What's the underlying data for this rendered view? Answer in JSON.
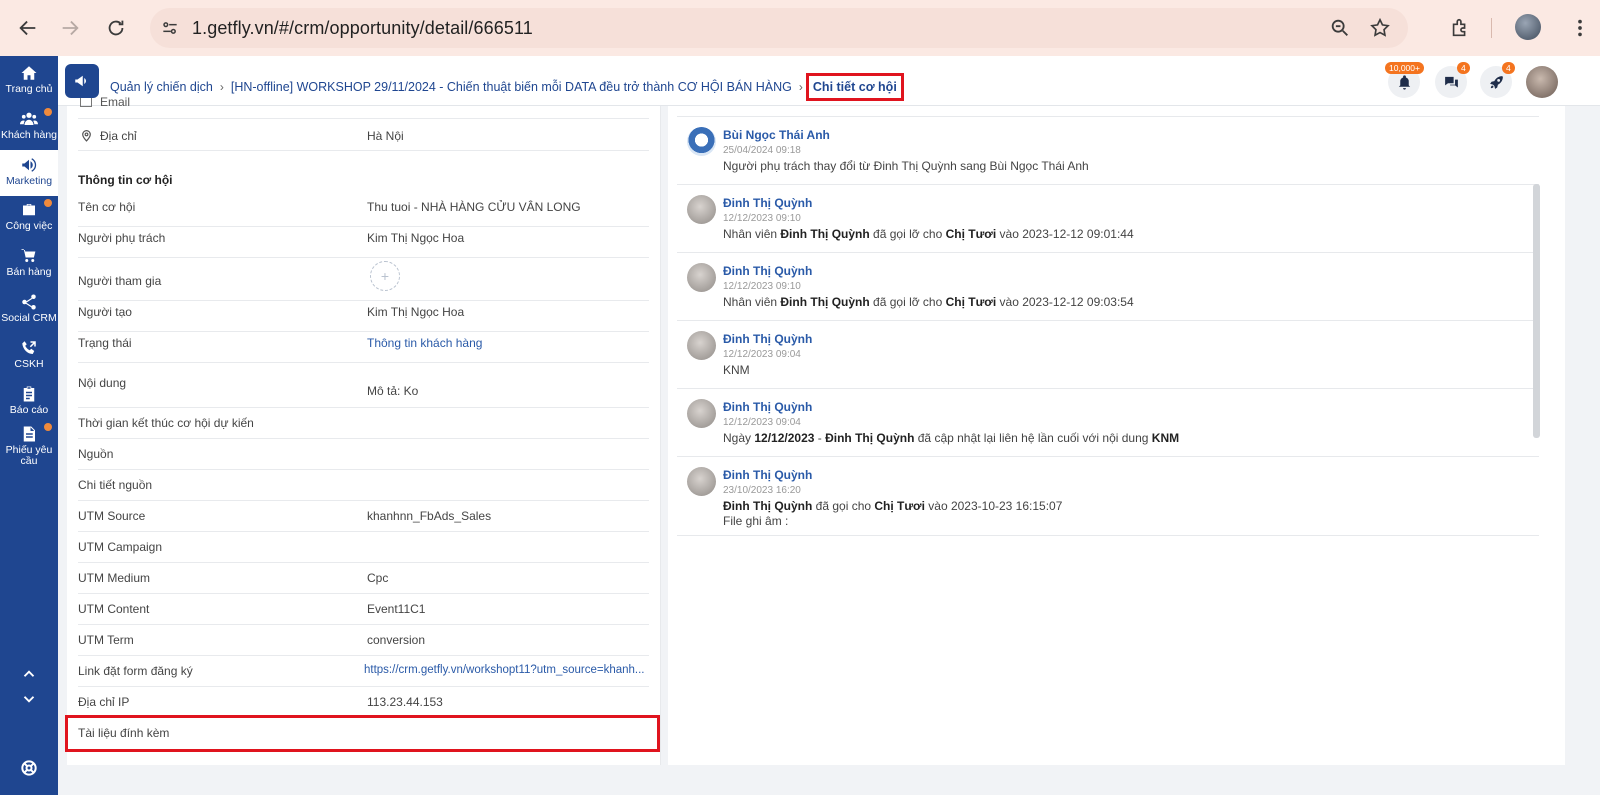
{
  "browser": {
    "url": "1.getfly.vn/#/crm/opportunity/detail/666511"
  },
  "sidebar": {
    "items": [
      {
        "label": "Trang chủ",
        "icon": "home-icon",
        "dot": false
      },
      {
        "label": "Khách hàng",
        "icon": "users-icon",
        "dot": true
      },
      {
        "label": "Marketing",
        "icon": "megaphone-icon",
        "dot": false,
        "active": true
      },
      {
        "label": "Công việc",
        "icon": "briefcase-icon",
        "dot": true
      },
      {
        "label": "Bán hàng",
        "icon": "cart-icon",
        "dot": false
      },
      {
        "label": "Social CRM",
        "icon": "share-icon",
        "dot": false
      },
      {
        "label": "CSKH",
        "icon": "phone-icon",
        "dot": false
      },
      {
        "label": "Báo cáo",
        "icon": "clipboard-icon",
        "dot": false
      },
      {
        "label": "Phiếu yêu cầu",
        "icon": "document-icon",
        "dot": true
      }
    ]
  },
  "header": {
    "breadcrumb": [
      "Quản lý chiến dịch",
      "[HN-offline] WORKSHOP 29/11/2024 - Chiến thuật biến mỗi DATA đều trở thành CƠ HỘI BÁN HÀNG",
      "Chi tiết cơ hội"
    ],
    "notifications_badge": "10,000+",
    "chat_badge": "4",
    "rocket_badge": "4"
  },
  "contact": {
    "email_label": "Email",
    "address_label": "Địa chỉ",
    "address_value": "Hà Nội"
  },
  "opportunity": {
    "section_title": "Thông tin cơ hội",
    "fields": [
      {
        "label": "Tên cơ hội",
        "value": "Thu tuoi - NHÀ HÀNG CỬU VÂN LONG"
      },
      {
        "label": "Người phụ trách",
        "value": "Kim Thị Ngọc Hoa"
      },
      {
        "label": "Người tham gia",
        "value": "+"
      },
      {
        "label": "Người tạo",
        "value": "Kim Thị Ngọc Hoa"
      },
      {
        "label": "Trạng thái",
        "value": "Thông tin khách hàng"
      },
      {
        "label": "Nội dung",
        "value": "Mô tả: Ko"
      },
      {
        "label": "Thời gian kết thúc cơ hội dự kiến",
        "value": ""
      },
      {
        "label": "Nguồn",
        "value": ""
      },
      {
        "label": "Chi tiết nguồn",
        "value": ""
      },
      {
        "label": "UTM Source",
        "value": "khanhnn_FbAds_Sales"
      },
      {
        "label": "UTM Campaign",
        "value": ""
      },
      {
        "label": "UTM Medium",
        "value": "Cpc"
      },
      {
        "label": "UTM Content",
        "value": "Event11C1"
      },
      {
        "label": "UTM Term",
        "value": "conversion"
      },
      {
        "label": "Link đặt form đăng ký",
        "value": "https://crm.getfly.vn/workshopt11?utm_source=khanh..."
      },
      {
        "label": "Địa chỉ IP",
        "value": "113.23.44.153"
      },
      {
        "label": "Tài liệu đính kèm",
        "value": ""
      }
    ]
  },
  "activity": [
    {
      "name": "Bùi Ngọc Thái Anh",
      "time": "25/04/2024 09:18",
      "text": "Người phụ trách thay đổi từ Đinh Thị Quỳnh sang Bùi Ngọc Thái Anh"
    },
    {
      "name": "Đinh Thị Quỳnh",
      "time": "12/12/2023 09:10",
      "t1": "Nhân viên ",
      "b1": "Đinh Thị Quỳnh",
      "t2": " đã gọi lỡ cho ",
      "b2": "Chị Tươi",
      "t3": " vào 2023-12-12 09:01:44"
    },
    {
      "name": "Đinh Thị Quỳnh",
      "time": "12/12/2023 09:10",
      "t1": "Nhân viên ",
      "b1": "Đinh Thị Quỳnh",
      "t2": " đã gọi lỡ cho ",
      "b2": "Chị Tươi",
      "t3": " vào 2023-12-12 09:03:54"
    },
    {
      "name": "Đinh Thị Quỳnh",
      "time": "12/12/2023 09:04",
      "text": "KNM"
    },
    {
      "name": "Đinh Thị Quỳnh",
      "time": "12/12/2023 09:04",
      "t1": "Ngày ",
      "b1": "12/12/2023",
      "t2": " - ",
      "b2": "Đinh Thị Quỳnh",
      "t3": " đã cập nhật lại liên hệ lần cuối với nội dung ",
      "b3": "KNM"
    },
    {
      "name": "Đinh Thị Quỳnh",
      "time": "23/10/2023 16:20",
      "b1": "Đinh Thị Quỳnh",
      "t2": " đã gọi cho ",
      "b2": "Chị Tươi",
      "t3": " vào 2023-10-23 16:15:07",
      "line2": "File ghi âm :"
    }
  ],
  "colors": {
    "sidebar": "#1f4690",
    "highlight": "#e0141e",
    "badge": "#f4741f",
    "link": "#2a5aa8"
  }
}
